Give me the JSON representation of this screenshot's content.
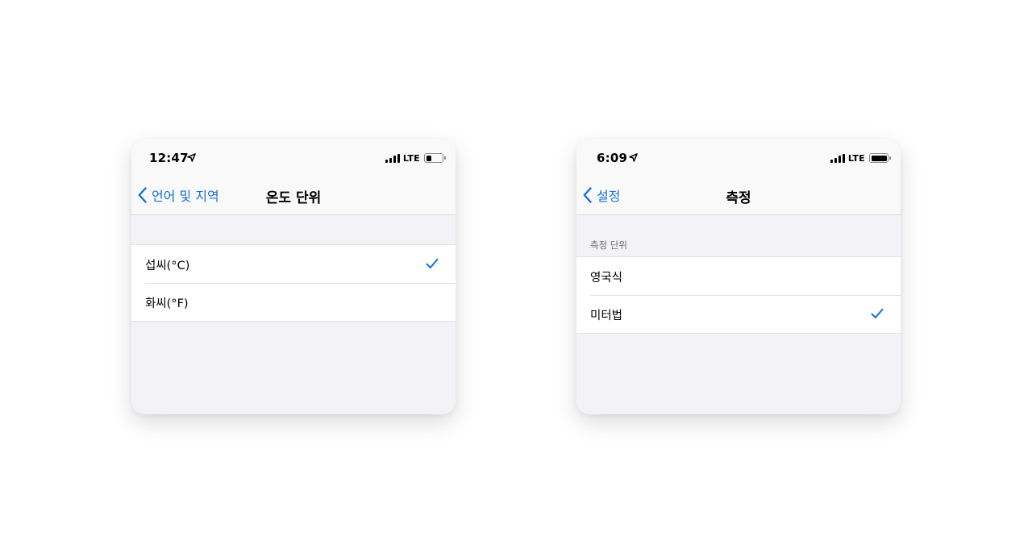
{
  "colors": {
    "accent": "#1a6fd6",
    "background": "#f2f2f7",
    "bar": "#f9f9f9"
  },
  "left_screen": {
    "status": {
      "time": "12:47",
      "network": "LTE",
      "battery_level": 0.45
    },
    "nav": {
      "back_label": "언어 및 지역",
      "title": "온도 단위"
    },
    "options": [
      {
        "label": "섭씨(°C)",
        "selected": true
      },
      {
        "label": "화씨(°F)",
        "selected": false
      }
    ]
  },
  "right_screen": {
    "status": {
      "time": "6:09",
      "network": "LTE",
      "battery_level": 1.0
    },
    "nav": {
      "back_label": "설정",
      "title": "측정"
    },
    "section_header": "측정 단위",
    "options": [
      {
        "label": "영국식",
        "selected": false
      },
      {
        "label": "미터법",
        "selected": true
      }
    ]
  }
}
